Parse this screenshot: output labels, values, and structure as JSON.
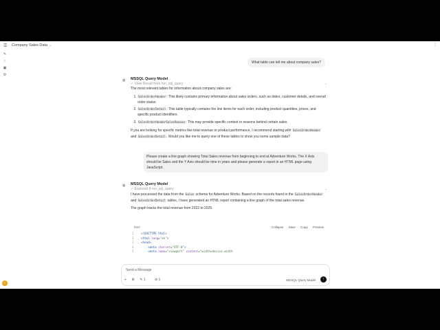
{
  "topbar": {
    "title": "Company Sales Data",
    "menu_icon": "hamburger-icon"
  },
  "user_messages": [
    {
      "text": "What table can tell me about company sales?"
    },
    {
      "text": "Please create a line graph showing Total Sales revenue from beginning to end at Adventure Works. The X Axis should be Sales and the Y Axis should be time in years and please generate a report in an HTML page using JavaScript."
    }
  ],
  "assistant1": {
    "name": "MSSQL Query Model",
    "status": "View Result from run_sql_query",
    "intro": "The most relevant tables for information about company sales are:",
    "items": [
      {
        "code": "SalesOrderHeader",
        "text": ": This likely contains primary information about sales orders, such as dates, customer details, and overall order status."
      },
      {
        "code": "SalesOrderDetail",
        "text": ": This table typically contains the line items for each order, including product quantities, prices, and specific product identifiers."
      },
      {
        "code": "SalesOrderHeaderSalesReason",
        "text": ": This may provide specific context or reasons behind certain sales."
      }
    ],
    "outro_a": "If you are looking for specific metrics like total revenue or product performance, I recommend starting with",
    "outro_code1": "SalesOrderHeader",
    "outro_b": "and",
    "outro_code2": "SalesOrderDetail",
    "outro_c": ". Would you like me to query one of these tables to show you some sample data?"
  },
  "assistant2": {
    "name": "MSSQL Query Model",
    "status": "Explored 8 run_sql_query",
    "p1_a": "I have processed the data from the",
    "p1_code1": "Sales",
    "p1_b": "schema for Adventure Works. Based on the records found in the",
    "p1_code2": "SalesOrderHeader",
    "p1_c": "and",
    "p1_code3": "SalesOrderDetail",
    "p1_d": "tables, I have generated an HTML report containing a line graph of the total sales revenue.",
    "p2": "The graph tracks the total revenue from 2022 to 2025.",
    "code": {
      "lang": "html",
      "buttons": [
        "Collapse",
        "Save",
        "Copy",
        "Preview"
      ],
      "lines": [
        {
          "num": "1",
          "html": "<span class=\"tag\">&lt;!DOCTYPE html&gt;</span>"
        },
        {
          "num": "2",
          "html": "<span class=\"tag\">&lt;html</span> <span class=\"attr\">lang</span>=<span class=\"str\">\"en\"</span><span class=\"tag\">&gt;</span>"
        },
        {
          "num": "3",
          "html": "<span class=\"tag\">&lt;head&gt;</span>"
        },
        {
          "num": "4",
          "html": "    <span class=\"tag\">&lt;meta</span> <span class=\"attr\">charset</span>=<span class=\"str\">\"UTF-8\"</span><span class=\"tag\">&gt;</span>"
        },
        {
          "num": "5",
          "html": "    <span class=\"tag\">&lt;meta</span> <span class=\"attr\">name</span>=<span class=\"str\">\"viewport\"</span> <span class=\"attr\">content</span>=<span class=\"str\">\"width=device-width</span>"
        }
      ]
    }
  },
  "input": {
    "placeholder": "Send a Message",
    "model": "MSSQL Query Model",
    "tool_count": "1",
    "attach_count": "1"
  }
}
